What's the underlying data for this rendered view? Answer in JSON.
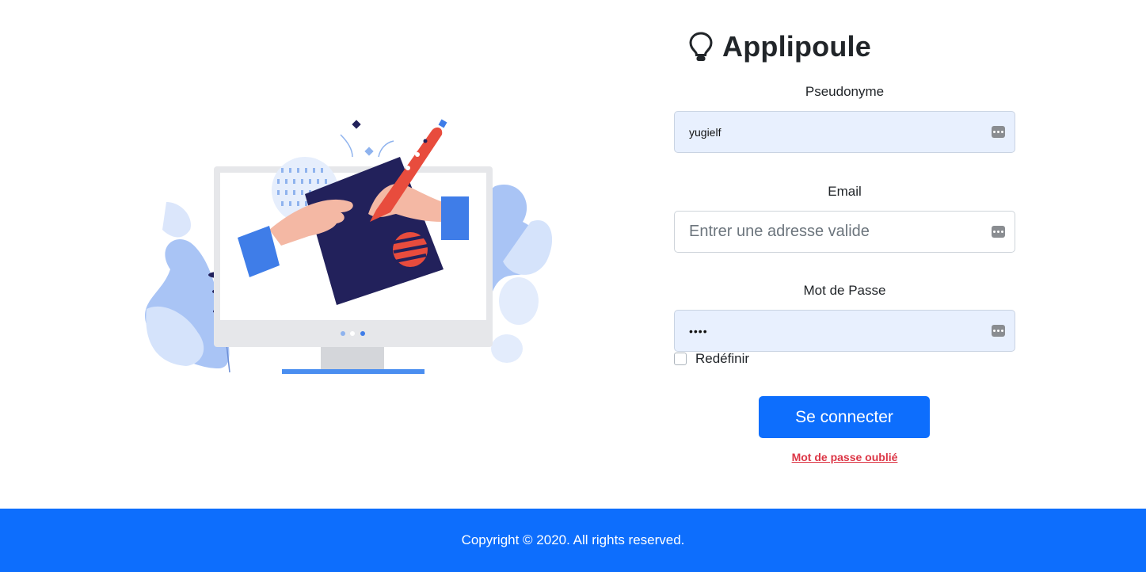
{
  "brand": {
    "name": "Applipoule",
    "icon": "lightbulb-icon"
  },
  "form": {
    "username": {
      "label": "Pseudonyme",
      "value": "yugielf",
      "icon": "password-manager-key-icon"
    },
    "email": {
      "label": "Email",
      "placeholder": "Entrer une adresse valide",
      "value": "",
      "icon": "password-manager-key-icon"
    },
    "password": {
      "label": "Mot de Passe",
      "masked_value": "••••",
      "icon": "password-manager-key-icon"
    },
    "remember": {
      "label": "Redéfinir",
      "checked": false
    },
    "submit_label": "Se connecter",
    "forgot_label": "Mot de passe oublié"
  },
  "footer": {
    "copyright": "Copyright © 2020. All rights reserved."
  },
  "colors": {
    "primary": "#0d6efd",
    "danger": "#dc3545",
    "autofill": "#e8f0fe",
    "navy": "#22215b"
  }
}
